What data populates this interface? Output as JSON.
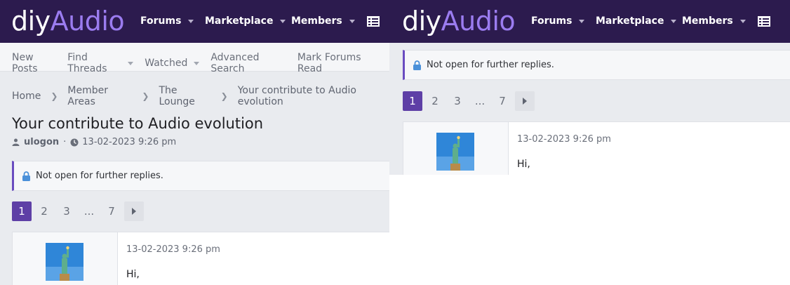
{
  "logo": {
    "part1": "diy",
    "part2": "Audio"
  },
  "nav": {
    "forums": "Forums",
    "marketplace": "Marketplace",
    "members": "Members",
    "menu_icon": "list-icon"
  },
  "subnav": {
    "new_posts": "New Posts",
    "find_threads": "Find Threads",
    "watched": "Watched",
    "advanced_search": "Advanced Search",
    "mark_read": "Mark Forums Read"
  },
  "breadcrumb": [
    "Home",
    "Member Areas",
    "The Lounge",
    "Your contribute to Audio evolution"
  ],
  "thread": {
    "title": "Your contribute to Audio evolution",
    "author": "ulogon",
    "date": "13-02-2023 9:26 pm"
  },
  "notice": "Not open for further replies.",
  "pagination": [
    "1",
    "2",
    "3",
    "...",
    "7"
  ],
  "post": {
    "date": "13-02-2023 9:26 pm",
    "body": "Hi,"
  },
  "colors": {
    "header_bg": "#2c1b4e",
    "accent": "#5e3fa6",
    "logo_accent": "#9b7cf0"
  }
}
